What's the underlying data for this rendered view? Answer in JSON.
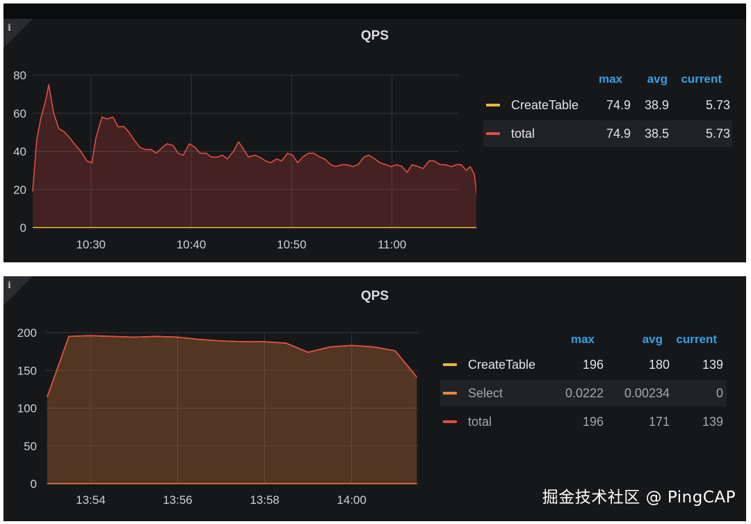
{
  "watermark": "掘金技术社区 @ PingCAP",
  "panels": [
    {
      "title": "QPS",
      "info_icon": "i",
      "legend": {
        "headers": [
          "max",
          "avg",
          "current"
        ],
        "rows": [
          {
            "name": "CreateTable",
            "color": "#eab839",
            "max": "74.9",
            "avg": "38.9",
            "current": "5.73"
          },
          {
            "name": "total",
            "color": "#e24d42",
            "max": "74.9",
            "avg": "38.5",
            "current": "5.73"
          }
        ]
      }
    },
    {
      "title": "QPS",
      "info_icon": "i",
      "legend": {
        "headers": [
          "max",
          "avg",
          "current"
        ],
        "rows": [
          {
            "name": "CreateTable",
            "color": "#eab839",
            "max": "196",
            "avg": "180",
            "current": "139"
          },
          {
            "name": "Select",
            "color": "#ef843c",
            "max": "0.0222",
            "avg": "0.00234",
            "current": "0"
          },
          {
            "name": "total",
            "color": "#e24d42",
            "max": "196",
            "avg": "171",
            "current": "139"
          }
        ]
      }
    }
  ],
  "chart_data": [
    {
      "type": "area",
      "title": "QPS",
      "x_unit": "minutes",
      "x_tick_labels": [
        "10:30",
        "10:40",
        "10:50",
        "11:00"
      ],
      "x_tick_values": [
        630,
        640,
        650,
        660
      ],
      "xlim": [
        624.2,
        666.6
      ],
      "ylim": [
        0,
        80
      ],
      "y_ticks": [
        0,
        20,
        40,
        60,
        80
      ],
      "grid": true,
      "legend_position": "right",
      "series": [
        {
          "name": "total",
          "color": "#e24d42",
          "points": [
            [
              624.2,
              19
            ],
            [
              624.6,
              46
            ],
            [
              625.0,
              57
            ],
            [
              625.5,
              67
            ],
            [
              625.8,
              75
            ],
            [
              626.3,
              60
            ],
            [
              626.8,
              52
            ],
            [
              627.4,
              50
            ],
            [
              627.9,
              47
            ],
            [
              628.5,
              43
            ],
            [
              629.0,
              40
            ],
            [
              629.6,
              35
            ],
            [
              630.1,
              34
            ],
            [
              630.5,
              47
            ],
            [
              631.1,
              58
            ],
            [
              631.6,
              57
            ],
            [
              632.2,
              58
            ],
            [
              632.7,
              53
            ],
            [
              633.3,
              53
            ],
            [
              633.8,
              50
            ],
            [
              634.3,
              46
            ],
            [
              634.9,
              42
            ],
            [
              635.4,
              41
            ],
            [
              636.0,
              41
            ],
            [
              636.5,
              39
            ],
            [
              637.1,
              42
            ],
            [
              637.6,
              44
            ],
            [
              638.2,
              43
            ],
            [
              638.7,
              39
            ],
            [
              639.2,
              38
            ],
            [
              639.8,
              44
            ],
            [
              640.4,
              42
            ],
            [
              640.9,
              39
            ],
            [
              641.5,
              39
            ],
            [
              642.0,
              37
            ],
            [
              642.6,
              37
            ],
            [
              643.1,
              38
            ],
            [
              643.6,
              36
            ],
            [
              644.2,
              40
            ],
            [
              644.7,
              45
            ],
            [
              645.1,
              42
            ],
            [
              645.7,
              37
            ],
            [
              646.3,
              38
            ],
            [
              646.8,
              37
            ],
            [
              647.4,
              35
            ],
            [
              647.9,
              34
            ],
            [
              648.5,
              36
            ],
            [
              649.0,
              35
            ],
            [
              649.6,
              39
            ],
            [
              650.1,
              38
            ],
            [
              650.6,
              34
            ],
            [
              651.1,
              37
            ],
            [
              651.7,
              39
            ],
            [
              652.2,
              39
            ],
            [
              652.8,
              37
            ],
            [
              653.3,
              36
            ],
            [
              653.9,
              33
            ],
            [
              654.4,
              32
            ],
            [
              655.0,
              33
            ],
            [
              655.5,
              33
            ],
            [
              656.1,
              32
            ],
            [
              656.6,
              33
            ],
            [
              657.2,
              37
            ],
            [
              657.7,
              38
            ],
            [
              658.3,
              36
            ],
            [
              658.8,
              34
            ],
            [
              659.4,
              33
            ],
            [
              659.9,
              32
            ],
            [
              660.5,
              33
            ],
            [
              661.0,
              32
            ],
            [
              661.5,
              29
            ],
            [
              662.0,
              33
            ],
            [
              662.6,
              32
            ],
            [
              663.1,
              31
            ],
            [
              663.7,
              35
            ],
            [
              664.2,
              35
            ],
            [
              664.8,
              33
            ],
            [
              665.3,
              33
            ],
            [
              665.9,
              32
            ],
            [
              666.4,
              33
            ],
            [
              666.9,
              33
            ],
            [
              667.4,
              30
            ],
            [
              667.8,
              32
            ],
            [
              668.2,
              28
            ],
            [
              668.7,
              6
            ]
          ]
        },
        {
          "name": "CreateTable",
          "color": "#eab839",
          "points": [
            [
              624.2,
              0
            ],
            [
              668.7,
              0
            ]
          ]
        }
      ]
    },
    {
      "type": "area",
      "title": "QPS",
      "x_unit": "minutes",
      "x_tick_labels": [
        "13:54",
        "13:56",
        "13:58",
        "14:00"
      ],
      "x_tick_values": [
        834,
        836,
        838,
        840
      ],
      "xlim": [
        832.97,
        841.54
      ],
      "ylim": [
        0,
        200
      ],
      "y_ticks": [
        0,
        50,
        100,
        150,
        200
      ],
      "grid": true,
      "legend_position": "right",
      "series": [
        {
          "name": "CreateTable",
          "color": "#eab839",
          "points": [
            [
              833,
              115
            ],
            [
              833.5,
              195
            ],
            [
              834,
              196
            ],
            [
              834.5,
              195
            ],
            [
              835,
              194
            ],
            [
              835.5,
              195
            ],
            [
              836,
              194
            ],
            [
              836.5,
              191
            ],
            [
              837,
              189
            ],
            [
              837.5,
              188
            ],
            [
              838,
              188
            ],
            [
              838.5,
              186
            ],
            [
              839,
              174
            ],
            [
              839.5,
              181
            ],
            [
              840,
              183
            ],
            [
              840.5,
              181
            ],
            [
              841,
              176
            ],
            [
              841.5,
              141
            ]
          ]
        },
        {
          "name": "total",
          "color": "#e24d42",
          "points": [
            [
              833,
              115
            ],
            [
              833.5,
              195
            ],
            [
              834,
              196
            ],
            [
              834.5,
              195
            ],
            [
              835,
              194
            ],
            [
              835.5,
              195
            ],
            [
              836,
              194
            ],
            [
              836.5,
              191
            ],
            [
              837,
              189
            ],
            [
              837.5,
              188
            ],
            [
              838,
              188
            ],
            [
              838.5,
              186
            ],
            [
              839,
              174
            ],
            [
              839.5,
              181
            ],
            [
              840,
              183
            ],
            [
              840.5,
              181
            ],
            [
              841,
              176
            ],
            [
              841.5,
              141
            ]
          ]
        },
        {
          "name": "Select",
          "color": "#ef843c",
          "points": [
            [
              833,
              0
            ],
            [
              841.5,
              0
            ]
          ]
        }
      ]
    }
  ]
}
